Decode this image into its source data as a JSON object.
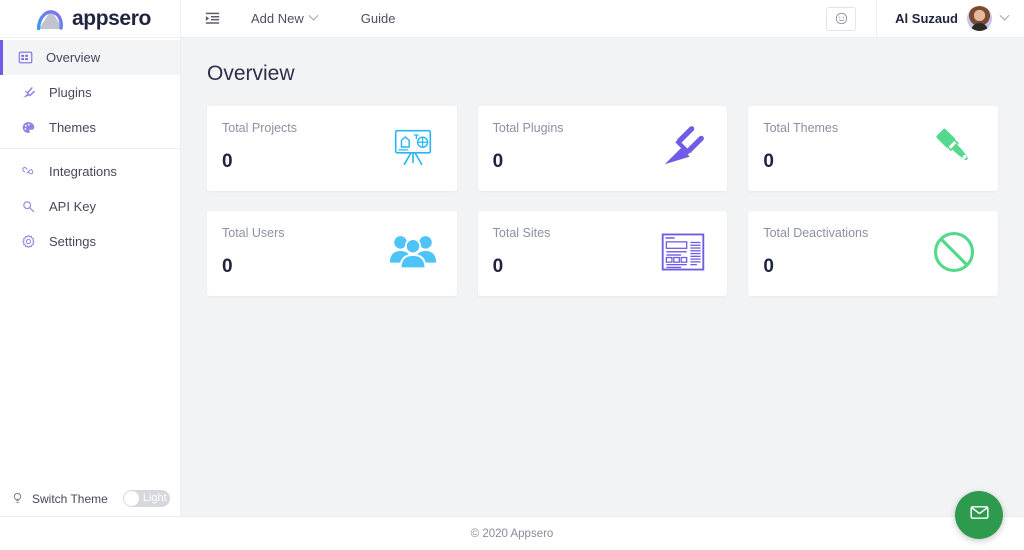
{
  "brand": {
    "name": "appsero",
    "logo_icon": "appsero-swoosh-logo"
  },
  "topnav": {
    "menu_icon": "menu-indent-icon",
    "links": [
      {
        "label": "Add New",
        "has_caret": true,
        "icon": "chevron-down-icon"
      },
      {
        "label": "Guide",
        "has_caret": false
      }
    ],
    "smiley_icon": "smiley-face-icon",
    "user": {
      "name": "Al Suzaud",
      "avatar_icon": "user-avatar",
      "caret_icon": "chevron-down-icon"
    }
  },
  "sidebar": {
    "groups": [
      {
        "items": [
          {
            "label": "Overview",
            "icon": "dashboard-grid-icon",
            "active": true
          },
          {
            "label": "Plugins",
            "icon": "plug-icon",
            "active": false
          },
          {
            "label": "Themes",
            "icon": "paint-palette-icon",
            "active": false
          }
        ]
      },
      {
        "items": [
          {
            "label": "Integrations",
            "icon": "link-chain-icon",
            "active": false
          },
          {
            "label": "API Key",
            "icon": "key-search-icon",
            "active": false
          },
          {
            "label": "Settings",
            "icon": "gear-icon",
            "active": false
          }
        ]
      }
    ],
    "switch_theme": {
      "label": "Switch Theme",
      "icon": "lightbulb-icon",
      "toggle_label": "Light",
      "toggle_state": "off"
    }
  },
  "main": {
    "title": "Overview",
    "cards": [
      {
        "label": "Total Projects",
        "value": "0",
        "icon": "easel-presentation-icon",
        "color": "#2ab6f6"
      },
      {
        "label": "Total Plugins",
        "value": "0",
        "icon": "plug-icon",
        "color": "#6c5ce7"
      },
      {
        "label": "Total Themes",
        "value": "0",
        "icon": "paint-brush-icon",
        "color": "#54d98c"
      },
      {
        "label": "Total Users",
        "value": "0",
        "icon": "people-group-icon",
        "color": "#4ec3f7"
      },
      {
        "label": "Total Sites",
        "value": "0",
        "icon": "webpage-layout-icon",
        "color": "#6c5ce7"
      },
      {
        "label": "Total Deactivations",
        "value": "0",
        "icon": "prohibited-circle-icon",
        "color": "#54d98c"
      }
    ]
  },
  "footer": {
    "copyright": "© 2020 Appsero"
  },
  "chat": {
    "icon": "envelope-icon",
    "color": "#2e9a4e"
  },
  "colors": {
    "accent_purple": "#6c5ce7",
    "page_bg": "#f2f3f5",
    "card_bg": "#ffffff",
    "text_dark": "#21243f",
    "text_muted": "#8b90a3"
  }
}
